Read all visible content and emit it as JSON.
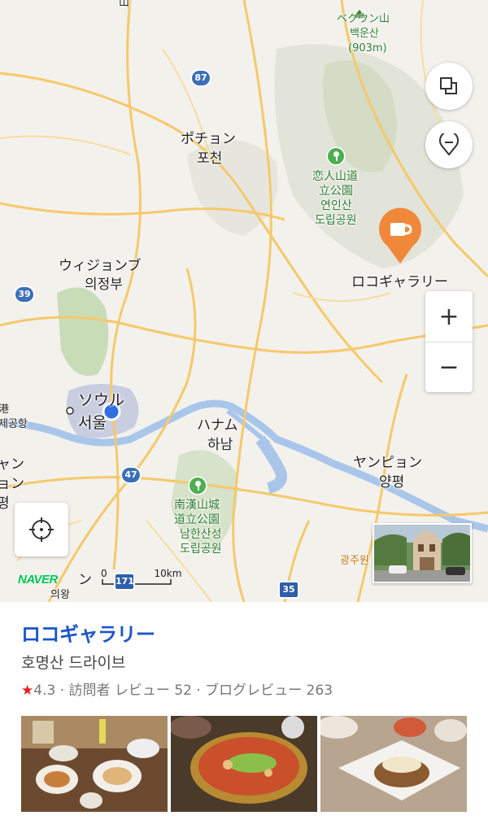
{
  "map": {
    "labels": {
      "baekun_jp": "ベクウン山",
      "baekun_kr": "백운산",
      "baekun_height": "(903m)",
      "pocheon_jp": "ポチョン",
      "pocheon_kr": "포천",
      "park1_jp": "恋人山道",
      "park1_jp2": "立公園",
      "park1_kr": "연인산",
      "park1_kr2": "도립공원",
      "place_marker": "ロコギャラリー",
      "uijeongbu_jp": "ウィジョンブ",
      "uijeongbu_kr": "의정부",
      "seoul_jp": "ソウル",
      "seoul_kr": "서울",
      "hanam_jp": "ハナム",
      "hanam_kr": "하남",
      "yangpyeong_jp": "ヤンピョン",
      "yangpyeong_kr": "양평",
      "park2_jp": "南漢山城",
      "park2_jp2": "道立公園",
      "park2_kr": "남한산성",
      "park2_kr2": "도립공원",
      "gwangju": "광주원",
      "left_edge1": "山",
      "left_edge2": "港",
      "left_edge3": "제공항",
      "left_edge4": "ャン",
      "left_edge5": "ョン",
      "left_edge6": "평",
      "bottom_left1": "ン",
      "bottom_left2": "의왕"
    },
    "roads": [
      "87",
      "39",
      "47",
      "171",
      "35"
    ],
    "scale_zero": "0",
    "scale_label": "10km",
    "brand": "NAVER",
    "accent_color": "#f0883a"
  },
  "controls": {
    "layers_icon": "layers-icon",
    "pin_icon": "location-pin-icon",
    "zoom_in": "+",
    "zoom_out": "−",
    "locate_icon": "crosshair-icon"
  },
  "place": {
    "title": "ロコギャラリー",
    "subtitle": "호명산 드라이브",
    "rating": "4.3",
    "meta": " · 訪問者 レビュー 52 · ブログレビュー 263",
    "title_color": "#1a56c9"
  }
}
